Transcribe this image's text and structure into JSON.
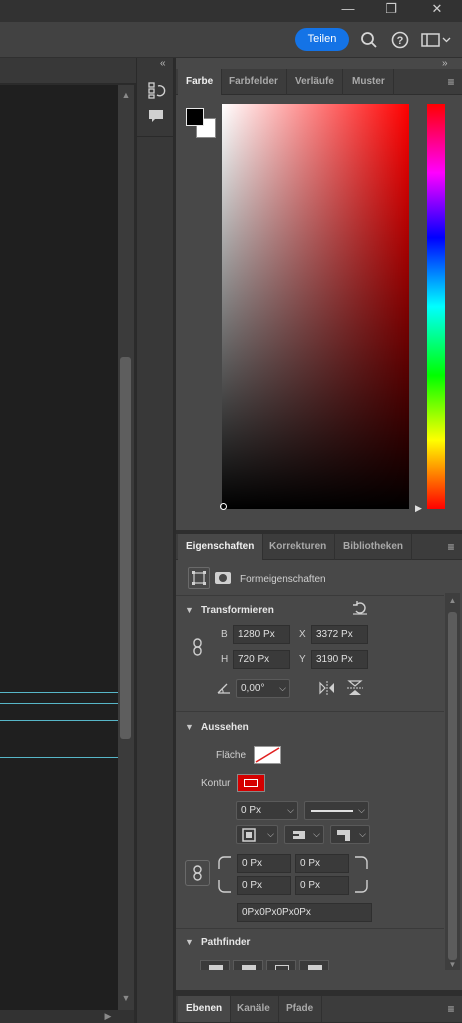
{
  "window": {
    "minimize": "—",
    "restore": "❐",
    "close": "✕"
  },
  "header": {
    "share_label": "Teilen"
  },
  "color_panel": {
    "tabs": [
      {
        "label": "Farbe",
        "active": true
      },
      {
        "label": "Farbfelder",
        "active": false
      },
      {
        "label": "Verläufe",
        "active": false
      },
      {
        "label": "Muster",
        "active": false
      }
    ],
    "foreground": "#000000",
    "background": "#ffffff",
    "hue_color": "#ff0000"
  },
  "properties_panel": {
    "tabs": [
      {
        "label": "Eigenschaften",
        "active": true
      },
      {
        "label": "Korrekturen",
        "active": false
      },
      {
        "label": "Bibliotheken",
        "active": false
      }
    ],
    "shape_label": "Formeigenschaften",
    "transform": {
      "title": "Transformieren",
      "w_label": "B",
      "w_value": "1280 Px",
      "x_label": "X",
      "x_value": "3372 Px",
      "h_label": "H",
      "h_value": "720 Px",
      "y_label": "Y",
      "y_value": "3190 Px",
      "angle_value": "0,00°"
    },
    "appearance": {
      "title": "Aussehen",
      "fill_label": "Fläche",
      "stroke_label": "Kontur",
      "stroke_width": "0 Px",
      "corner_tl": "0 Px",
      "corner_tr": "0 Px",
      "corner_bl": "0 Px",
      "corner_br": "0 Px",
      "corner_summary": "0Px0Px0Px0Px",
      "stroke_color": "#d40000"
    },
    "pathfinder": {
      "title": "Pathfinder"
    }
  },
  "bottom_panel": {
    "tabs": [
      {
        "label": "Ebenen",
        "active": true
      },
      {
        "label": "Kanäle",
        "active": false
      },
      {
        "label": "Pfade",
        "active": false
      }
    ]
  }
}
